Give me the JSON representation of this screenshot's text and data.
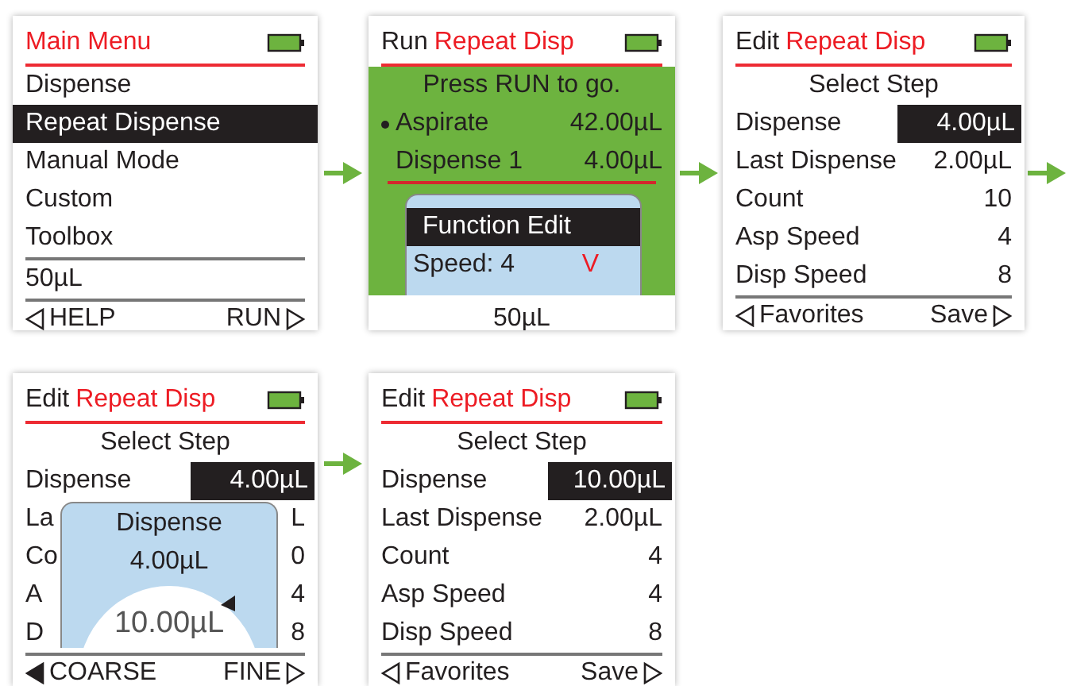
{
  "screens": [
    {
      "kind": "menu",
      "title": {
        "program": "Main Menu"
      },
      "items": [
        {
          "label": "Dispense",
          "selected": false
        },
        {
          "label": "Repeat Dispense",
          "selected": true
        },
        {
          "label": "Manual Mode",
          "selected": false
        },
        {
          "label": "Custom",
          "selected": false
        },
        {
          "label": "Toolbox",
          "selected": false
        }
      ],
      "volume": "50µL",
      "footer": {
        "left": "HELP",
        "right": "RUN",
        "left_selected": false
      }
    },
    {
      "kind": "run",
      "title": {
        "mode": "Run",
        "program": "Repeat Disp"
      },
      "prompt": "Press RUN to go.",
      "steps": [
        {
          "label": "Aspirate",
          "value": "42.00µL",
          "current": true
        },
        {
          "label": "Dispense 1",
          "value": "4.00µL",
          "current": false
        }
      ],
      "popup": {
        "title": "Function Edit",
        "label": "Speed: 4",
        "mark": "V"
      },
      "volume": "50µL"
    },
    {
      "kind": "edit",
      "title": {
        "mode": "Edit",
        "program": "Repeat Disp"
      },
      "subtitle": "Select Step",
      "rows": [
        {
          "label": "Dispense",
          "value": "4.00µL",
          "selected": true
        },
        {
          "label": "Last Dispense",
          "value": "2.00µL",
          "selected": false
        },
        {
          "label": "Count",
          "value": "10",
          "selected": false
        },
        {
          "label": "Asp Speed",
          "value": "4",
          "selected": false
        },
        {
          "label": "Disp Speed",
          "value": "8",
          "selected": false
        }
      ],
      "footer": {
        "left": "Favorites",
        "right": "Save",
        "left_selected": false
      }
    },
    {
      "kind": "adjust",
      "title": {
        "mode": "Edit",
        "program": "Repeat Disp"
      },
      "subtitle": "Select Step",
      "rows": [
        {
          "label": "Dispense",
          "value": "4.00µL",
          "selected": true
        },
        {
          "label": "La",
          "value": "L",
          "selected": false
        },
        {
          "label": "Co",
          "value": "0",
          "selected": false
        },
        {
          "label": "A",
          "value": "4",
          "selected": false
        },
        {
          "label": "D",
          "value": "8",
          "selected": false
        }
      ],
      "popup": {
        "title": "Dispense",
        "value": "4.00µL",
        "dial": "10.00µL"
      },
      "footer": {
        "left": "COARSE",
        "right": "FINE",
        "left_selected": true
      }
    },
    {
      "kind": "edit",
      "title": {
        "mode": "Edit",
        "program": "Repeat Disp"
      },
      "subtitle": "Select Step",
      "rows": [
        {
          "label": "Dispense",
          "value": "10.00µL",
          "selected": true
        },
        {
          "label": "Last Dispense",
          "value": "2.00µL",
          "selected": false
        },
        {
          "label": "Count",
          "value": "4",
          "selected": false
        },
        {
          "label": "Asp Speed",
          "value": "4",
          "selected": false
        },
        {
          "label": "Disp Speed",
          "value": "8",
          "selected": false
        }
      ],
      "footer": {
        "left": "Favorites",
        "right": "Save",
        "left_selected": false
      }
    }
  ]
}
